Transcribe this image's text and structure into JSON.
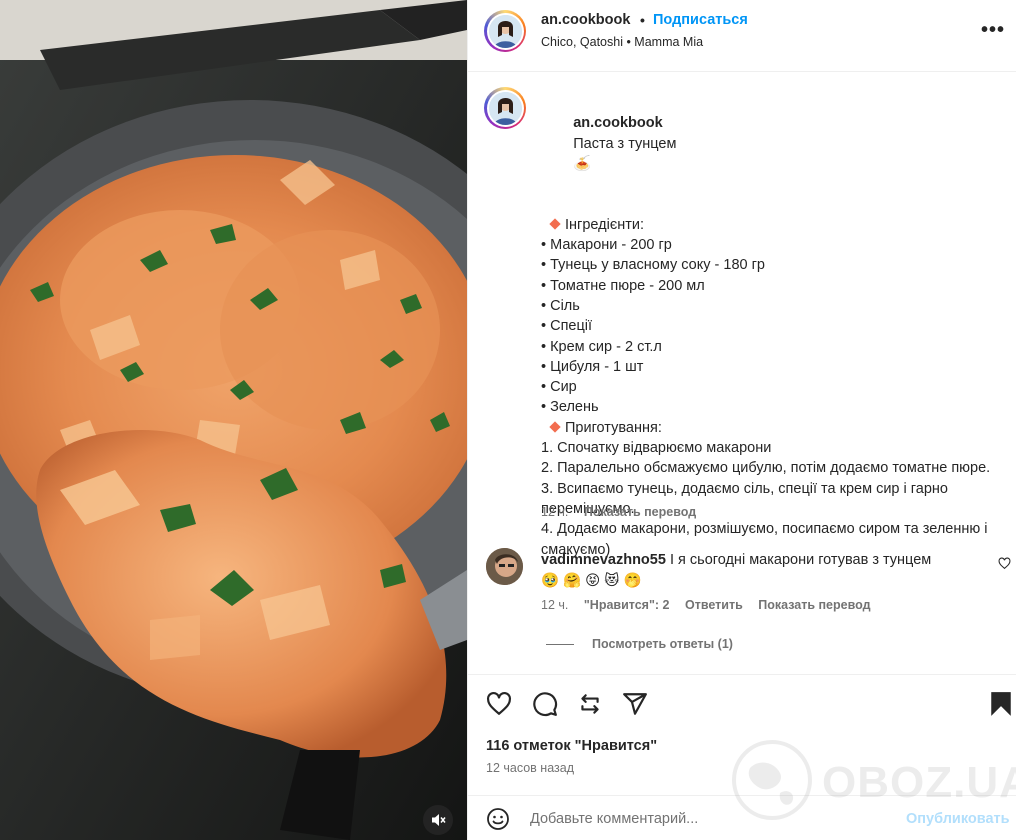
{
  "post": {
    "username": "an.cookbook",
    "separator": "•",
    "follow_label": "Подписаться",
    "audio": "Chico, Qatoshi • Mamma Mia",
    "more_label": "•••"
  },
  "caption": {
    "username": "an.cookbook",
    "title": "Паста з тунцем",
    "title_emoji": "🍝",
    "ingredients_heading": "Інгредієнти:",
    "ingredients": [
      "• Макарони - 200 гр",
      "• Тунець у власному соку - 180 гр",
      "• Томатне пюре - 200 мл",
      "• Сіль",
      "• Спеції",
      "• Крем сир - 2 ст.л",
      "• Цибуля - 1 шт",
      "• Сир",
      "• Зелень"
    ],
    "steps_heading": "Приготування:",
    "steps": [
      "1. Спочатку відварюємо макарони",
      "2. Паралельно обсмажуємо цибулю, потім додаємо томатне пюре.",
      "3. Всипаємо тунець, додаємо сіль, спеції та крем сир і гарно перемішуємо.",
      "4. Додаємо макарони, розмішуємо, посипаємо сиром та зеленню і смакуємо)"
    ],
    "time": "12 ч.",
    "translate_label": "Показать перевод"
  },
  "comment": {
    "username": "vadimnevazhno55",
    "text": "І я сьогодні макарони готував з тунцем",
    "emojis": "🥹 🤗 😝 😻 🤭",
    "time": "12 ч.",
    "likes_label": "\"Нравится\": 2",
    "reply_label": "Ответить",
    "translate_label": "Показать перевод",
    "view_replies_label": "Посмотреть ответы (1)"
  },
  "actions": {
    "icons": [
      "heart-icon",
      "comment-icon",
      "share-icon",
      "send-icon",
      "bookmark-icon"
    ],
    "likes_count": "116 отметок \"Нравится\"",
    "posted_ago": "12 часов назад"
  },
  "add_comment": {
    "placeholder": "Добавьте комментарий...",
    "publish_label": "Опубликовать"
  },
  "watermark": {
    "text": "OBOZ.UA"
  },
  "colors": {
    "accent": "#0095f6",
    "publish_disabled": "#b2dffc",
    "muted": "#737373",
    "text": "#262626",
    "diamond": "#f26d4f"
  }
}
